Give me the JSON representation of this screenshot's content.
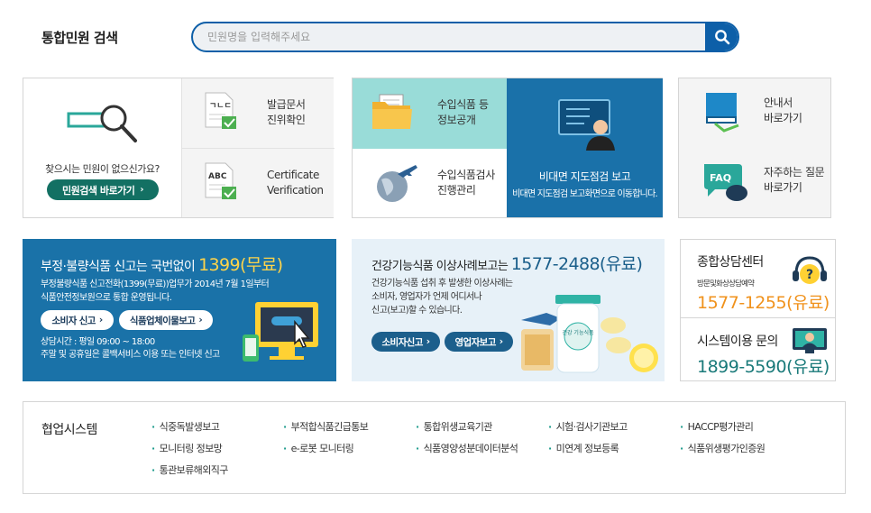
{
  "search": {
    "title": "통합민원 검색",
    "placeholder": "민원명을 입력해주세요"
  },
  "row1": {
    "finder": {
      "question": "찾으시는 민원이 없으신가요?",
      "button": "민원검색 바로가기"
    },
    "doc_verify": {
      "line1": "발급문서",
      "line2": "진위확인"
    },
    "cert_verify": {
      "line1": "Certificate",
      "line2": "Verification"
    },
    "import_info": {
      "line1": "수입식품 등",
      "line2": "정보공개"
    },
    "import_inspect": {
      "line1": "수입식품검사",
      "line2": "진행관리"
    },
    "remote_report": {
      "title": "비대면 지도점검 보고",
      "subtitle": "비대면 지도점검 보고화면으로 이동합니다."
    },
    "guide": {
      "line1": "안내서",
      "line2": "바로가기"
    },
    "faq": {
      "line1": "자주하는 질문",
      "line2": "바로가기",
      "badge": "FAQ"
    },
    "doc_icon_text": "ㄱㄴㄷ",
    "cert_icon_text": "ABC"
  },
  "row2": {
    "report": {
      "title": "부정·불량식품 신고는 국번없이",
      "number": "1399(무료)",
      "desc1": "부정불량식품 신고전화(1399(무료))업무가 2014년 7월 1일부터",
      "desc2": "식품안전정보원으로 통합 운영됩니다.",
      "btn1": "소비자 신고",
      "btn2": "식품업체이물보고",
      "hours1": "상담시간 : 평일 09:00 ~ 18:00",
      "hours2": "주말 및 공휴일은 콜백서비스 이용 또는 인터넷 신고"
    },
    "health": {
      "title": "건강기능식품 이상사례보고는",
      "number": "1577-2488(유료)",
      "desc1": "건강기능식품 섭취 후 발생한 이상사례는",
      "desc2": "소비자, 영업자가 언제 어디서나",
      "desc3": "신고(보고)할 수 있습니다.",
      "btn1": "소비자신고",
      "btn2": "영업자보고",
      "bottle_label": "건강 기능식품"
    },
    "contact": {
      "title": "종합상담센터",
      "sub": "방문및화상상담예약",
      "number": "1577-1255(유료)",
      "system_title": "시스템이용 문의",
      "system_number": "1899-5590(유료)"
    }
  },
  "row3": {
    "title": "협업시스템",
    "links": [
      "식중독발생보고",
      "부적합식품긴급통보",
      "통합위생교육기관",
      "시험·검사기관보고",
      "HACCP평가관리",
      "모니터링 정보망",
      "e-로봇 모니터링",
      "식품영양성분데이터분석",
      "미연계 정보등록",
      "식품위생평가인증원",
      "통관보류해외직구"
    ]
  },
  "colors": {
    "primary": "#0d5fa8",
    "teal": "#137063",
    "mint": "#99dcd8",
    "blue_panel": "#1a72a8",
    "light_panel": "#e7f1f8",
    "orange": "#f0921c",
    "yellow": "#ffd44a"
  }
}
